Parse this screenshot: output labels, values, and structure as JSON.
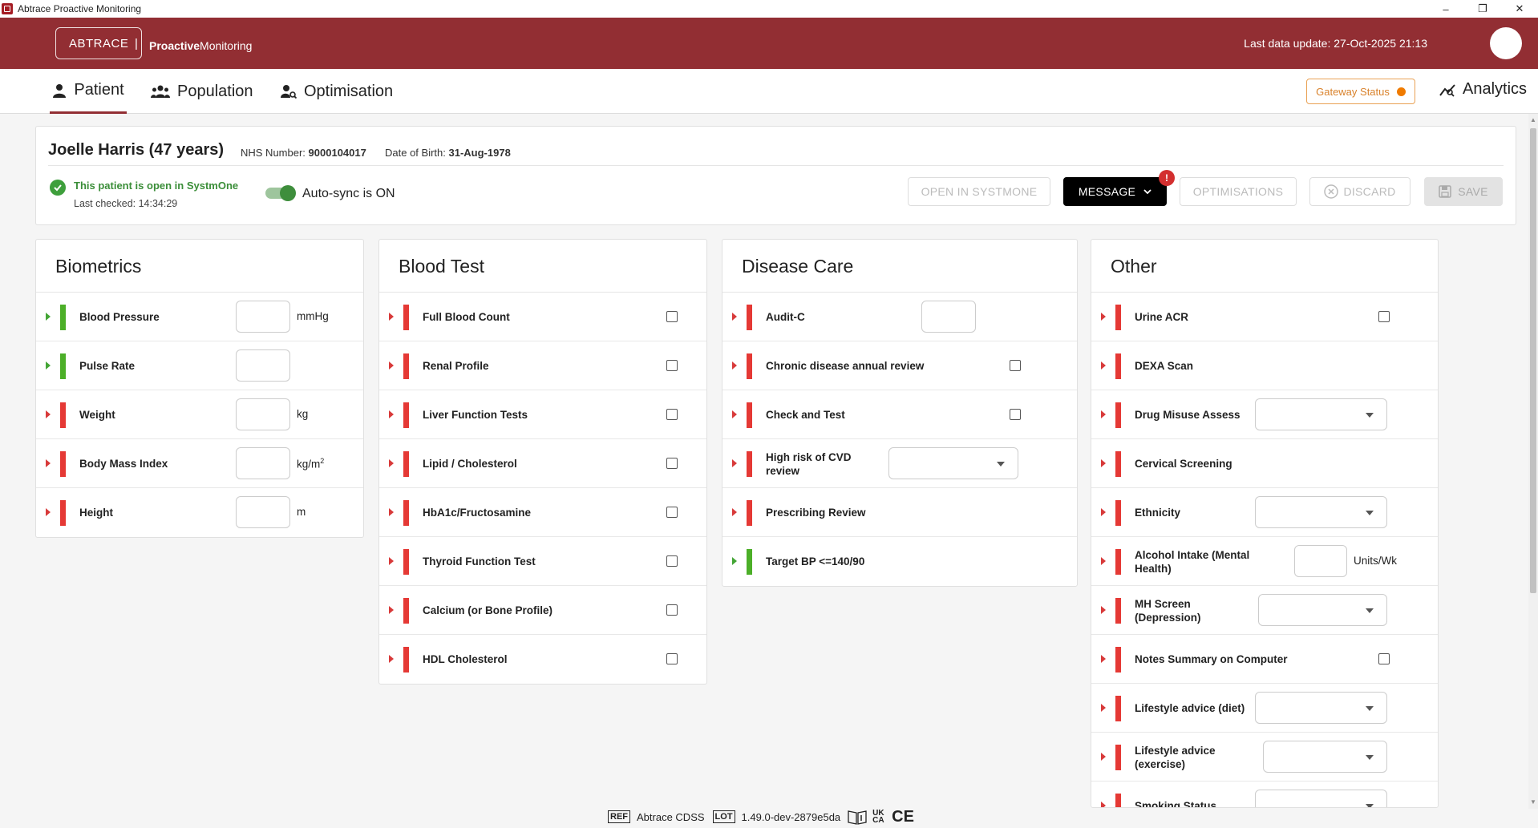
{
  "window": {
    "title": "Abtrace Proactive Monitoring",
    "controls": [
      "–",
      "❐",
      "✕"
    ]
  },
  "header": {
    "logo_text": "ABTRACE",
    "separator": "|",
    "product_bold": "Proactive",
    "product_rest": "Monitoring",
    "last_update": "Last data update: 27-Oct-2025 21:13",
    "brand_color": "#922e33"
  },
  "nav": {
    "tabs": [
      {
        "label": "Patient",
        "active": true
      },
      {
        "label": "Population",
        "active": false
      },
      {
        "label": "Optimisation",
        "active": false
      }
    ],
    "gateway_label": "Gateway Status",
    "gateway_status_color": "#f07b00",
    "analytics_label": "Analytics"
  },
  "patient": {
    "name": "Joelle Harris (47 years)",
    "nhs_label": "NHS Number:",
    "nhs_value": "9000104017",
    "dob_label": "Date of Birth:",
    "dob_value": "31-Aug-1978",
    "open_status": "This patient is open in SystmOne",
    "last_checked": "Last checked: 14:34:29",
    "autosync_label": "Auto-sync is ON",
    "autosync_on": true
  },
  "actions": {
    "open_systmone": "OPEN IN SYSTMONE",
    "message": "MESSAGE",
    "message_badge": "!",
    "optimisations": "OPTIMISATIONS",
    "discard": "DISCARD",
    "save": "SAVE"
  },
  "panels": {
    "biometrics": {
      "title": "Biometrics",
      "items": [
        {
          "label": "Blood Pressure",
          "status": "green",
          "value": "",
          "unit": "mmHg"
        },
        {
          "label": "Pulse Rate",
          "status": "green",
          "value": "",
          "unit": ""
        },
        {
          "label": "Weight",
          "status": "red",
          "value": "",
          "unit": "kg"
        },
        {
          "label": "Body Mass Index",
          "status": "red",
          "value": "",
          "unit": "kg/m",
          "unit_sup": "2"
        },
        {
          "label": "Height",
          "status": "red",
          "value": "",
          "unit": "m"
        }
      ]
    },
    "blood_test": {
      "title": "Blood Test",
      "items": [
        {
          "label": "Full Blood Count",
          "status": "red",
          "checked": false
        },
        {
          "label": "Renal Profile",
          "status": "red",
          "checked": false
        },
        {
          "label": "Liver Function Tests",
          "status": "red",
          "checked": false
        },
        {
          "label": "Lipid / Cholesterol",
          "status": "red",
          "checked": false
        },
        {
          "label": "HbA1c/Fructosamine",
          "status": "red",
          "checked": false
        },
        {
          "label": "Thyroid Function Test",
          "status": "red",
          "checked": false
        },
        {
          "label": "Calcium (or Bone Profile)",
          "status": "red",
          "checked": false
        },
        {
          "label": "HDL Cholesterol",
          "status": "red",
          "checked": false
        }
      ]
    },
    "disease_care": {
      "title": "Disease Care",
      "items": [
        {
          "label": "Audit-C",
          "status": "red",
          "control": "input",
          "value": ""
        },
        {
          "label": "Chronic disease annual review",
          "status": "red",
          "control": "checkbox",
          "checked": false
        },
        {
          "label": "Check and Test",
          "status": "red",
          "control": "checkbox",
          "checked": false
        },
        {
          "label": "High risk of CVD review",
          "status": "red",
          "control": "select",
          "value": ""
        },
        {
          "label": "Prescribing Review",
          "status": "red",
          "control": "none"
        },
        {
          "label": "Target BP <=140/90",
          "status": "green",
          "control": "none"
        }
      ]
    },
    "other": {
      "title": "Other",
      "items": [
        {
          "label": "Urine ACR",
          "status": "red",
          "control": "checkbox",
          "checked": false
        },
        {
          "label": "DEXA Scan",
          "status": "red",
          "control": "none"
        },
        {
          "label": "Drug Misuse Assess",
          "status": "red",
          "control": "select",
          "value": ""
        },
        {
          "label": "Cervical Screening",
          "status": "red",
          "control": "none"
        },
        {
          "label": "Ethnicity",
          "status": "red",
          "control": "select",
          "value": ""
        },
        {
          "label": "Alcohol Intake (Mental Health)",
          "status": "red",
          "control": "input",
          "value": "",
          "unit": "Units/Wk"
        },
        {
          "label": "MH Screen (Depression)",
          "status": "red",
          "control": "select",
          "value": ""
        },
        {
          "label": "Notes Summary on Computer",
          "status": "red",
          "control": "checkbox",
          "checked": false
        },
        {
          "label": "Lifestyle advice (diet)",
          "status": "red",
          "control": "select",
          "value": ""
        },
        {
          "label": "Lifestyle advice (exercise)",
          "status": "red",
          "control": "select",
          "value": ""
        },
        {
          "label": "Smoking Status",
          "status": "red",
          "control": "select",
          "value": ""
        }
      ]
    }
  },
  "footer": {
    "ref": "REF",
    "product": "Abtrace CDSS",
    "lot": "LOT",
    "version": "1.49.0-dev-2879e5da",
    "ukca": "UK CA",
    "ce": "CE"
  }
}
